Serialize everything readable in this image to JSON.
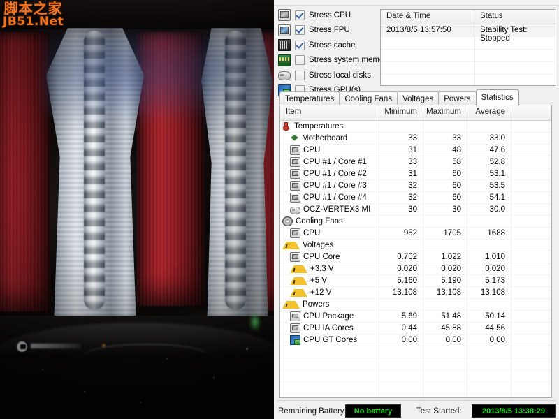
{
  "watermark": {
    "cn": "脚本之家",
    "en": "JB51.Net"
  },
  "stress_options": [
    {
      "label": "Stress CPU",
      "checked": true,
      "icon": "cpu-icon"
    },
    {
      "label": "Stress FPU",
      "checked": true,
      "icon": "fpu-icon"
    },
    {
      "label": "Stress cache",
      "checked": true,
      "icon": "cache-chip-icon"
    },
    {
      "label": "Stress system memory",
      "checked": false,
      "icon": "memory-icon"
    },
    {
      "label": "Stress local disks",
      "checked": false,
      "icon": "disk-icon"
    },
    {
      "label": "Stress GPU(s)",
      "checked": false,
      "icon": "gpu-icon"
    }
  ],
  "log_table": {
    "headers": [
      "Date & Time",
      "Status"
    ],
    "rows": [
      {
        "datetime": "2013/8/5 13:57:50",
        "status": "Stability Test: Stopped"
      }
    ],
    "empty_rows": 4
  },
  "tabs": [
    {
      "label": "Temperatures",
      "active": false
    },
    {
      "label": "Cooling Fans",
      "active": false
    },
    {
      "label": "Voltages",
      "active": false
    },
    {
      "label": "Powers",
      "active": false
    },
    {
      "label": "Statistics",
      "active": true
    }
  ],
  "statistics": {
    "headers": [
      "Item",
      "Minimum",
      "Maximum",
      "Average"
    ],
    "rows": [
      {
        "kind": "group",
        "icon": "thermometer-icon",
        "label": "Temperatures",
        "min": "",
        "max": "",
        "avg": ""
      },
      {
        "kind": "item",
        "icon": "motherboard-icon",
        "label": "Motherboard",
        "min": "33",
        "max": "33",
        "avg": "33.0"
      },
      {
        "kind": "item",
        "icon": "cpu-icon",
        "label": "CPU",
        "min": "31",
        "max": "48",
        "avg": "47.6"
      },
      {
        "kind": "item",
        "icon": "cpu-icon",
        "label": "CPU #1 / Core #1",
        "min": "33",
        "max": "58",
        "avg": "52.8"
      },
      {
        "kind": "item",
        "icon": "cpu-icon",
        "label": "CPU #1 / Core #2",
        "min": "31",
        "max": "60",
        "avg": "53.1"
      },
      {
        "kind": "item",
        "icon": "cpu-icon",
        "label": "CPU #1 / Core #3",
        "min": "32",
        "max": "60",
        "avg": "53.5"
      },
      {
        "kind": "item",
        "icon": "cpu-icon",
        "label": "CPU #1 / Core #4",
        "min": "32",
        "max": "60",
        "avg": "54.1"
      },
      {
        "kind": "item",
        "icon": "ssd-icon",
        "label": "OCZ-VERTEX3 MI",
        "min": "30",
        "max": "30",
        "avg": "30.0"
      },
      {
        "kind": "group",
        "icon": "fan-icon",
        "label": "Cooling Fans",
        "min": "",
        "max": "",
        "avg": ""
      },
      {
        "kind": "item",
        "icon": "cpu-icon",
        "label": "CPU",
        "min": "952",
        "max": "1705",
        "avg": "1688"
      },
      {
        "kind": "group",
        "icon": "warning-icon",
        "label": "Voltages",
        "min": "",
        "max": "",
        "avg": ""
      },
      {
        "kind": "item",
        "icon": "cpu-icon",
        "label": "CPU Core",
        "min": "0.702",
        "max": "1.022",
        "avg": "1.010"
      },
      {
        "kind": "item",
        "icon": "warning-icon",
        "label": "+3.3 V",
        "min": "0.020",
        "max": "0.020",
        "avg": "0.020"
      },
      {
        "kind": "item",
        "icon": "warning-icon",
        "label": "+5 V",
        "min": "5.160",
        "max": "5.190",
        "avg": "5.173"
      },
      {
        "kind": "item",
        "icon": "warning-icon",
        "label": "+12 V",
        "min": "13.108",
        "max": "13.108",
        "avg": "13.108"
      },
      {
        "kind": "group",
        "icon": "warning-icon",
        "label": "Powers",
        "min": "",
        "max": "",
        "avg": ""
      },
      {
        "kind": "item",
        "icon": "cpu-icon",
        "label": "CPU Package",
        "min": "5.69",
        "max": "51.48",
        "avg": "50.14"
      },
      {
        "kind": "item",
        "icon": "cpu-icon",
        "label": "CPU IA Cores",
        "min": "0.44",
        "max": "45.88",
        "avg": "44.56"
      },
      {
        "kind": "item",
        "icon": "gpu-icon",
        "label": "CPU GT Cores",
        "min": "0.00",
        "max": "0.00",
        "avg": "0.00"
      }
    ],
    "empty_rows": 5
  },
  "status_bar": {
    "battery_label": "Remaining Battery:",
    "battery_value": "No battery",
    "started_label": "Test Started:",
    "started_value": "2013/8/5 13:38:29",
    "lcd_color": "#19e019"
  }
}
